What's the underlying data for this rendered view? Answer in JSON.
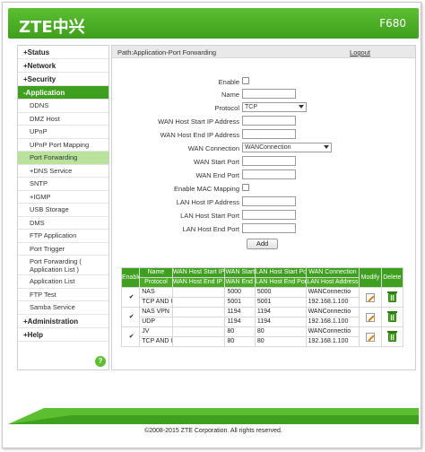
{
  "header": {
    "logo_text": "ZTE中兴",
    "model": "F680"
  },
  "sidebar": {
    "sections": [
      {
        "label": "+Status"
      },
      {
        "label": "+Network"
      },
      {
        "label": "+Security"
      },
      {
        "label": "-Application"
      }
    ],
    "items": [
      "DDNS",
      "DMZ Host",
      "UPnP",
      "UPnP Port Mapping",
      "Port Forwarding",
      "+DNS Service",
      "SNTP",
      "+IGMP",
      "USB Storage",
      "DMS",
      "FTP Application",
      "Port Trigger",
      "Port Forwarding ( Application List )",
      "Application List",
      "FTP Test",
      "Samba Service"
    ],
    "sections_after": [
      {
        "label": "+Administration"
      },
      {
        "label": "+Help"
      }
    ],
    "help_icon": "?"
  },
  "content": {
    "path": "Path:Application-Port Forwarding",
    "logout": "Logout"
  },
  "form": {
    "enable_label": "Enable",
    "name_label": "Name",
    "name_value": "",
    "protocol_label": "Protocol",
    "protocol_value": "TCP",
    "wan_start_ip_label": "WAN Host Start IP Address",
    "wan_end_ip_label": "WAN Host End IP Address",
    "wan_connection_label": "WAN Connection",
    "wan_connection_value": "WANConnection",
    "wan_start_port_label": "WAN Start Port",
    "wan_end_port_label": "WAN End Port",
    "mac_mapping_label": "Enable MAC Mapping",
    "lan_ip_label": "LAN Host IP Address",
    "lan_start_port_label": "LAN Host Start Port",
    "lan_end_port_label": "LAN Host End Port",
    "add_label": "Add"
  },
  "table": {
    "headers_top": [
      "Enable",
      "Name",
      "WAN Host Start IP Address",
      "WAN Start Port",
      "LAN Host Start Port",
      "WAN Connection",
      "Modify",
      "Delete"
    ],
    "headers_bottom": [
      "Protocol",
      "WAN Host End IP Address",
      "WAN End Port",
      "LAN Host End Port",
      "LAN Host Address"
    ],
    "rows": [
      {
        "name": "NAS",
        "protocol": "TCP AND U",
        "wan_start_ip": "",
        "wan_end_ip": "",
        "wan_start_port": "5000",
        "wan_end_port": "5001",
        "lan_start_port": "5000",
        "lan_end_port": "5001",
        "wan_conn": "WANConnectio",
        "lan_host": "192.168.1.100"
      },
      {
        "name": "NAS VPN",
        "protocol": "UDP",
        "wan_start_ip": "",
        "wan_end_ip": "",
        "wan_start_port": "1194",
        "wan_end_port": "1194",
        "lan_start_port": "1194",
        "lan_end_port": "1194",
        "wan_conn": "WANConnectio",
        "lan_host": "192.168.1.100"
      },
      {
        "name": "JV",
        "protocol": "TCP AND U",
        "wan_start_ip": "",
        "wan_end_ip": "",
        "wan_start_port": "80",
        "wan_end_port": "80",
        "lan_start_port": "80",
        "lan_end_port": "80",
        "wan_conn": "WANConnectio",
        "lan_host": "192.168.1.100"
      }
    ],
    "check_mark": "✔"
  },
  "footer": {
    "copyright": "©2008-2015 ZTE Corporation. All rights reserved."
  },
  "colors": {
    "brand_green": "#3f9f1e",
    "light_green": "#b9e39b"
  }
}
